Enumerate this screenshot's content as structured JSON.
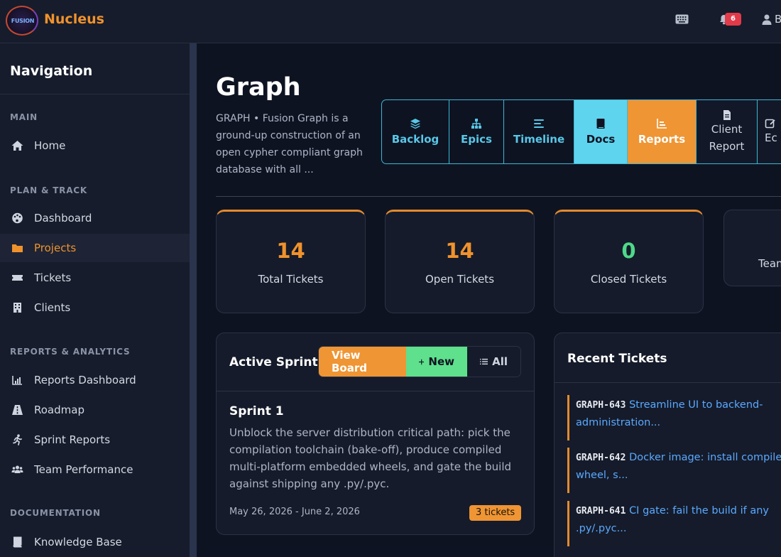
{
  "app": {
    "logo_text": "FUSION",
    "brand": "Nucleus",
    "notifications_count": "6",
    "user_name": "B"
  },
  "sidebar": {
    "heading": "Navigation",
    "sections": [
      {
        "label": "MAIN"
      },
      {
        "label": "PLAN & TRACK"
      },
      {
        "label": "REPORTS & ANALYTICS"
      },
      {
        "label": "DOCUMENTATION"
      }
    ],
    "items": [
      {
        "label": "Home",
        "icon": "home-icon"
      },
      {
        "label": "Dashboard",
        "icon": "palette-icon"
      },
      {
        "label": "Projects",
        "icon": "folder-icon",
        "active": true
      },
      {
        "label": "Tickets",
        "icon": "ticket-icon"
      },
      {
        "label": "Clients",
        "icon": "building-icon"
      },
      {
        "label": "Reports Dashboard",
        "icon": "chart-icon"
      },
      {
        "label": "Roadmap",
        "icon": "road-icon"
      },
      {
        "label": "Sprint Reports",
        "icon": "runner-icon"
      },
      {
        "label": "Team Performance",
        "icon": "team-icon"
      },
      {
        "label": "Knowledge Base",
        "icon": "book-icon"
      }
    ]
  },
  "project": {
    "title": "Graph",
    "description": "GRAPH • Fusion Graph is a ground-up construction of an open cypher compliant graph database with all ..."
  },
  "tabs": [
    {
      "label": "Backlog",
      "icon": "layers-icon"
    },
    {
      "label": "Epics",
      "icon": "hierarchy-icon"
    },
    {
      "label": "Timeline",
      "icon": "list-icon"
    },
    {
      "label": "Docs",
      "icon": "book-icon"
    },
    {
      "label": "Reports",
      "icon": "chart-icon"
    },
    {
      "label": "Client Report",
      "icon": "file-icon"
    },
    {
      "label": "Ec",
      "icon": "edit-icon"
    }
  ],
  "stats": [
    {
      "value": "14",
      "label": "Total Tickets"
    },
    {
      "value": "14",
      "label": "Open Tickets"
    },
    {
      "value": "0",
      "label": "Closed Tickets"
    },
    {
      "value": "",
      "label": "Tean"
    }
  ],
  "active_sprint": {
    "title": "Active Sprint",
    "view_board_label": "View Board",
    "new_label": "New",
    "all_label": "All",
    "sprint_name": "Sprint 1",
    "description": "Unblock the server distribution critical path: pick the compilation toolchain (bake-off), produce compiled multi-platform embedded wheels, and gate the build against shipping any .py/.pyc.",
    "dates": "May 26, 2026 - June 2, 2026",
    "ticket_count": "3 tickets"
  },
  "recent_tickets": {
    "title": "Recent Tickets",
    "items": [
      {
        "id": "GRAPH-643",
        "title": "Streamline UI to backend-administration..."
      },
      {
        "id": "GRAPH-642",
        "title": "Docker image: install compile wheel, s..."
      },
      {
        "id": "GRAPH-641",
        "title": "CI gate: fail the build if any .py/.pyc..."
      }
    ]
  }
}
